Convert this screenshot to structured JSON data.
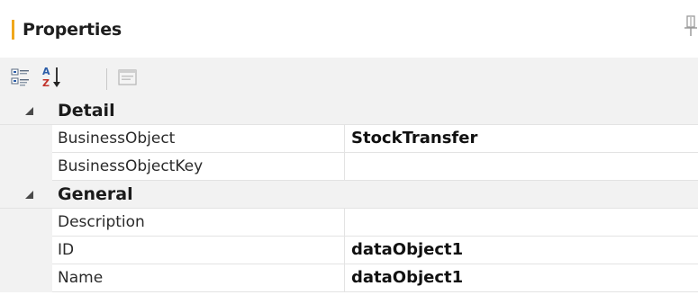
{
  "panel": {
    "title": "Properties",
    "accent_color": "#f0a71c"
  },
  "toolbar": {
    "buttons": [
      {
        "name": "categorized",
        "icon": "categorized-icon",
        "pressed": true
      },
      {
        "name": "alphabetical",
        "icon": "sort-az-icon",
        "pressed": false
      },
      {
        "name": "property-pages",
        "icon": "property-pages-icon",
        "enabled": false
      }
    ]
  },
  "grid": {
    "categories": [
      {
        "label": "Detail",
        "expanded": true,
        "properties": [
          {
            "name": "BusinessObject",
            "value": "StockTransfer"
          },
          {
            "name": "BusinessObjectKey",
            "value": ""
          }
        ]
      },
      {
        "label": "General",
        "expanded": true,
        "properties": [
          {
            "name": "Description",
            "value": ""
          },
          {
            "name": "ID",
            "value": "dataObject1"
          },
          {
            "name": "Name",
            "value": "dataObject1"
          }
        ]
      }
    ]
  }
}
